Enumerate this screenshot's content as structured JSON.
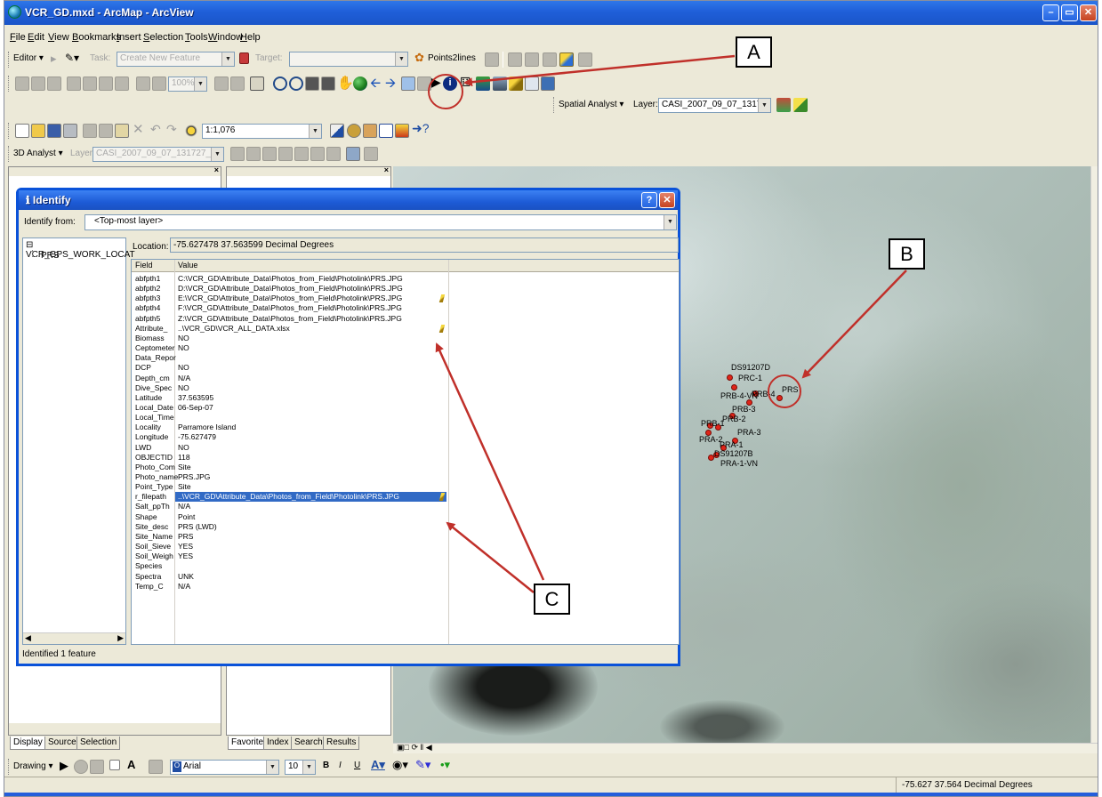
{
  "window": {
    "title": "VCR_GD.mxd - ArcMap - ArcView"
  },
  "menu": [
    "File",
    "Edit",
    "View",
    "Bookmarks",
    "Insert",
    "Selection",
    "Tools",
    "Window",
    "Help"
  ],
  "editor_toolbar": {
    "editor_label": "Editor ▾",
    "task_label": "Task:",
    "task_value": "Create New Feature",
    "target_label": "Target:",
    "target_value": "",
    "points2lines_label": "Points2lines"
  },
  "tools_toolbar": {
    "zoom_value": "100%"
  },
  "spatial_analyst": {
    "label": "Spatial Analyst ▾",
    "layer_label": "Layer:",
    "layer_value": "CASI_2007_09_07_131727_F10"
  },
  "standard_toolbar": {
    "scale_value": "1:1,076"
  },
  "analyst_3d": {
    "label": "3D Analyst ▾",
    "layer_label": "Layer:",
    "layer_value": "CASI_2007_09_07_131727_F10"
  },
  "identify": {
    "title": "Identify",
    "identify_from_label": "Identify from:",
    "identify_from_value": "<Top-most layer>",
    "tree_root": "VCR_GPS_WORK_LOCAT",
    "tree_child": "PRS",
    "location_label": "Location:",
    "location_value": "-75.627478  37.563599 Decimal Degrees",
    "columns": [
      "Field",
      "Value"
    ],
    "rows": [
      {
        "field": "abfpth1",
        "value": "C:\\VCR_GD\\Attribute_Data\\Photos_from_Field\\Photolink\\PRS.JPG",
        "link": false,
        "selected": false
      },
      {
        "field": "abfpth2",
        "value": "D:\\VCR_GD\\Attribute_Data\\Photos_from_Field\\Photolink\\PRS.JPG",
        "link": false,
        "selected": false
      },
      {
        "field": "abfpth3",
        "value": "E:\\VCR_GD\\Attribute_Data\\Photos_from_Field\\Photolink\\PRS.JPG",
        "link": true,
        "selected": false
      },
      {
        "field": "abfpth4",
        "value": "F:\\VCR_GD\\Attribute_Data\\Photos_from_Field\\Photolink\\PRS.JPG",
        "link": false,
        "selected": false
      },
      {
        "field": "abfpth5",
        "value": "Z:\\VCR_GD\\Attribute_Data\\Photos_from_Field\\Photolink\\PRS.JPG",
        "link": false,
        "selected": false
      },
      {
        "field": "Attribute_",
        "value": "..\\VCR_GD\\VCR_ALL_DATA.xlsx",
        "link": true,
        "selected": false
      },
      {
        "field": "Biomass",
        "value": "NO",
        "link": false,
        "selected": false
      },
      {
        "field": "Ceptometer",
        "value": "NO",
        "link": false,
        "selected": false
      },
      {
        "field": "Data_Repor",
        "value": "",
        "link": false,
        "selected": false
      },
      {
        "field": "DCP",
        "value": "NO",
        "link": false,
        "selected": false
      },
      {
        "field": "Depth_cm",
        "value": "N/A",
        "link": false,
        "selected": false
      },
      {
        "field": "Dive_Spec",
        "value": "NO",
        "link": false,
        "selected": false
      },
      {
        "field": "Latitude",
        "value": "37.563595",
        "link": false,
        "selected": false
      },
      {
        "field": "Local_Date",
        "value": "06-Sep-07",
        "link": false,
        "selected": false
      },
      {
        "field": "Local_Time",
        "value": "",
        "link": false,
        "selected": false
      },
      {
        "field": "Locality",
        "value": "Parramore Island",
        "link": false,
        "selected": false
      },
      {
        "field": "Longitude",
        "value": "-75.627479",
        "link": false,
        "selected": false
      },
      {
        "field": "LWD",
        "value": "NO",
        "link": false,
        "selected": false
      },
      {
        "field": "OBJECTID",
        "value": "118",
        "link": false,
        "selected": false
      },
      {
        "field": "Photo_Com",
        "value": "Site",
        "link": false,
        "selected": false
      },
      {
        "field": "Photo_name",
        "value": "PRS.JPG",
        "link": false,
        "selected": false
      },
      {
        "field": "Point_Type",
        "value": "Site",
        "link": false,
        "selected": false
      },
      {
        "field": "r_filepath",
        "value": "..\\VCR_GD\\Attribute_Data\\Photos_from_Field\\Photolink\\PRS.JPG",
        "link": true,
        "selected": true
      },
      {
        "field": "Salt_ppTh",
        "value": "N/A",
        "link": false,
        "selected": false
      },
      {
        "field": "Shape",
        "value": "Point",
        "link": false,
        "selected": false
      },
      {
        "field": "Site_desc",
        "value": "PRS (LWD)",
        "link": false,
        "selected": false
      },
      {
        "field": "Site_Name",
        "value": "PRS",
        "link": false,
        "selected": false
      },
      {
        "field": "Soil_Sieve",
        "value": "YES",
        "link": false,
        "selected": false
      },
      {
        "field": "Soil_Weigh",
        "value": "YES",
        "link": false,
        "selected": false
      },
      {
        "field": "Species",
        "value": "",
        "link": false,
        "selected": false
      },
      {
        "field": "Spectra",
        "value": "UNK",
        "link": false,
        "selected": false
      },
      {
        "field": "Temp_C",
        "value": "N/A",
        "link": false,
        "selected": false
      }
    ],
    "status": "Identified 1 feature"
  },
  "map_labels": [
    "DS91207D",
    "PRC-1",
    "PRB-4-VN",
    "PRB-4",
    "PRS",
    "PRB-3",
    "PRB-2",
    "PRB-1",
    "PRA-2",
    "PRA-3",
    "PRA-1",
    "DS91207B",
    "PRA-1-VN"
  ],
  "toc_tabs": [
    "Display",
    "Source",
    "Selection"
  ],
  "catalog_tabs": [
    "Favorites",
    "Index",
    "Search",
    "Results"
  ],
  "drawing_toolbar": {
    "label": "Drawing ▾",
    "font": "Arial",
    "size": "10",
    "bold": "B",
    "italic": "I",
    "underline": "U",
    "text_tool": "A"
  },
  "status_coords": "-75.627  37.564 Decimal Degrees",
  "callouts": [
    "A",
    "B",
    "C"
  ],
  "colors": {
    "titlebar": "#1f5fd9",
    "selection": "#316ac5",
    "callout_arrow": "#c0302a",
    "map_point": "#e02418"
  }
}
